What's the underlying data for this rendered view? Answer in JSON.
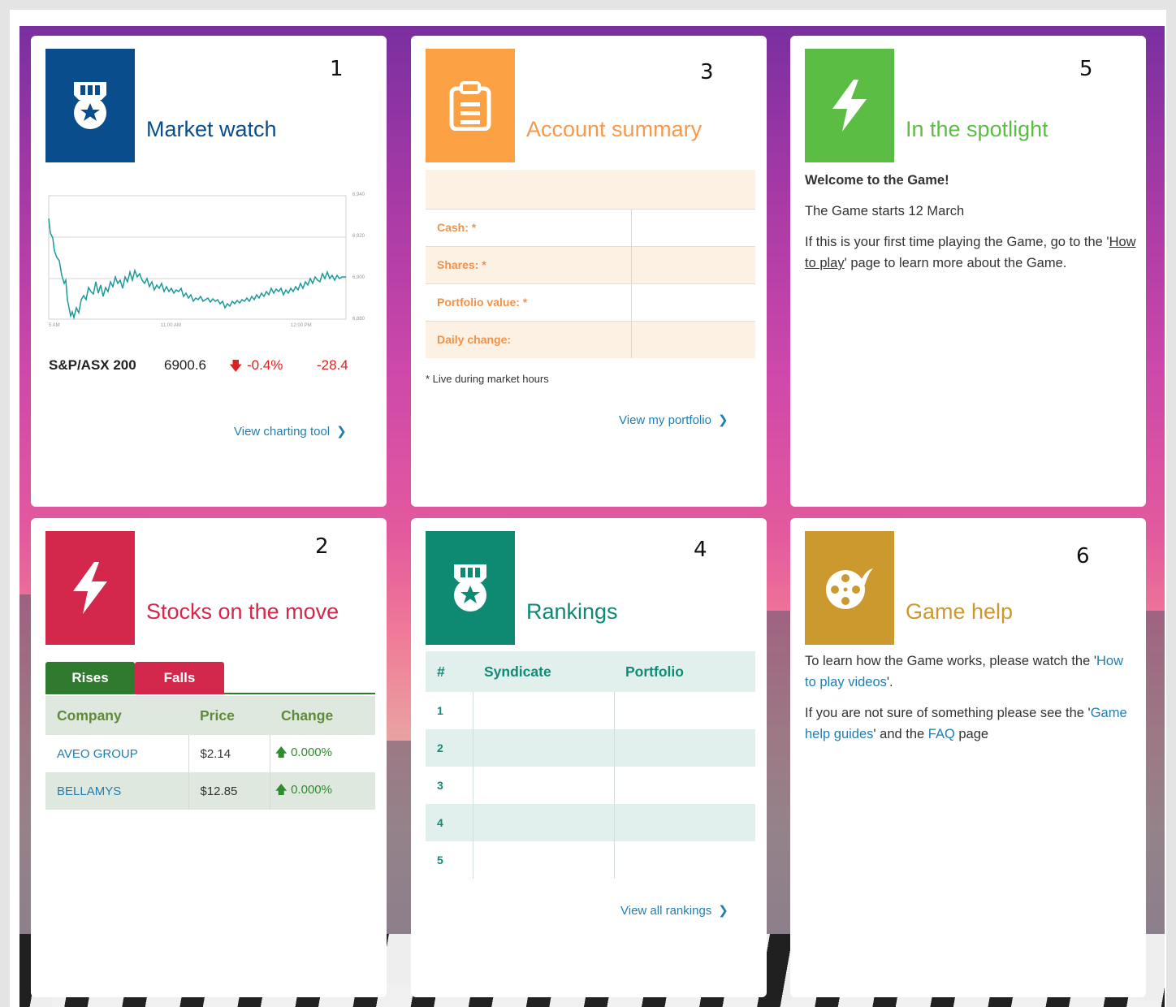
{
  "colors": {
    "market_blue": "#0a4d8c",
    "account_orange": "#fba043",
    "spotlight_green": "#5cbd45",
    "stocks_red": "#d3284b",
    "rankings_teal": "#0e8a72",
    "help_gold": "#cc992f",
    "link_blue": "#1f7fb3"
  },
  "market_watch": {
    "number": "1",
    "title": "Market watch",
    "icon": "medal-icon",
    "y_ticks": [
      "6,940",
      "6,920",
      "6,900",
      "6,880"
    ],
    "x_ticks": [
      "5 AM",
      "11:00 AM",
      "12:00 PM"
    ],
    "index_name": "S&P/ASX 200",
    "index_value": "6900.6",
    "index_change_pct": "-0.4%",
    "index_change_pts": "-28.4",
    "link": "View charting tool"
  },
  "account_summary": {
    "number": "3",
    "title": "Account summary",
    "icon": "clipboard-icon",
    "rows": [
      {
        "label": "Cash: *",
        "value": ""
      },
      {
        "label": "Shares: *",
        "value": ""
      },
      {
        "label": "Portfolio value: *",
        "value": ""
      },
      {
        "label": "Daily change:",
        "value": ""
      }
    ],
    "footnote": "* Live during market hours",
    "link": "View my portfolio"
  },
  "spotlight": {
    "number": "5",
    "title": "In the spotlight",
    "icon": "lightning-icon",
    "heading": "Welcome to the Game!",
    "line1": "The Game starts 12 March",
    "line2_a": "If this is your first time playing the Game, go to the '",
    "line2_link": "How to play",
    "line2_b": "' page to learn more about the Game."
  },
  "stocks_move": {
    "number": "2",
    "title": "Stocks on the move",
    "icon": "lightning-icon",
    "tabs": [
      "Rises",
      "Falls"
    ],
    "columns": [
      "Company",
      "Price",
      "Change"
    ],
    "rows": [
      {
        "company": "AVEO GROUP",
        "price": "$2.14",
        "change": "0.000%"
      },
      {
        "company": "BELLAMYS",
        "price": "$12.85",
        "change": "0.000%"
      }
    ]
  },
  "rankings": {
    "number": "4",
    "title": "Rankings",
    "icon": "medal-icon",
    "columns": [
      "#",
      "Syndicate",
      "Portfolio"
    ],
    "rows": [
      "1",
      "2",
      "3",
      "4",
      "5"
    ],
    "link": "View all rankings"
  },
  "game_help": {
    "number": "6",
    "title": "Game help",
    "icon": "film-reel-icon",
    "p1_a": "To learn how the Game works, please watch the '",
    "p1_link": "How to play videos",
    "p1_b": "'.",
    "p2_a": "If you are not sure of something please see the '",
    "p2_link1": "Game help guides",
    "p2_mid": "' and the ",
    "p2_link2": "FAQ",
    "p2_b": " page"
  }
}
